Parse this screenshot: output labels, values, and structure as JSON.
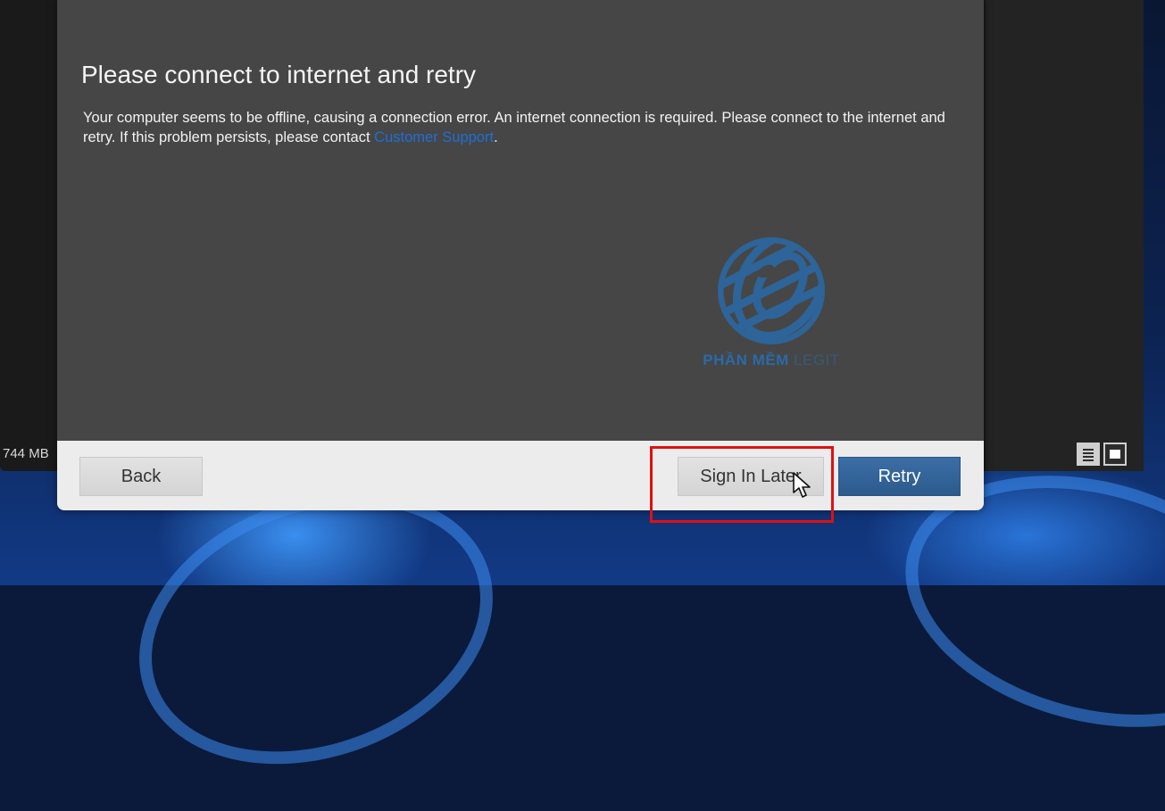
{
  "dialog": {
    "title": "Please connect to internet and retry",
    "body_text": "Your computer seems to be offline, causing a connection error. An internet connection is required. Please connect to the internet and retry. If this problem persists, please contact ",
    "link_text": "Customer Support",
    "body_suffix": "."
  },
  "footer": {
    "back_label": "Back",
    "sign_in_later_label": "Sign In Later",
    "retry_label": "Retry"
  },
  "background_window": {
    "memory_text": "744 MB"
  },
  "watermark": {
    "text_bold": "PHẦN MỀM",
    "text_light": "LEGIT"
  },
  "colors": {
    "dialog_bg": "#464646",
    "footer_bg": "#ececec",
    "retry_bg": "#2c5a8c",
    "link": "#1f6fd6",
    "highlight": "#e01010"
  },
  "icons": {
    "view_list": "list-view-icon",
    "view_tile": "tile-view-icon",
    "cursor": "mouse-pointer-icon",
    "watermark_logo": "globe-logo-icon"
  }
}
